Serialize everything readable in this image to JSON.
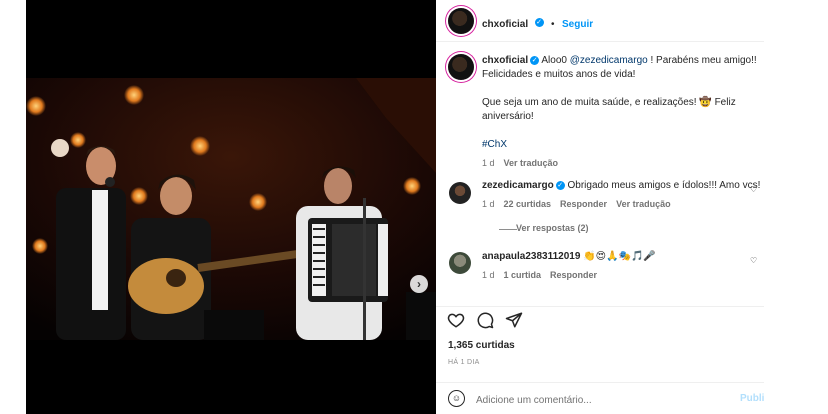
{
  "post": {
    "author": "chxoficial",
    "follow_label": "Seguir",
    "separator": "•",
    "caption_line1_prefix": "Aloo0 ",
    "caption_mention": "@zezedicamargo",
    "caption_line1_suffix": " ! Parabéns meu amigo!!",
    "caption_line2": "Felicidades e muitos anos de vida!",
    "caption_line3": "Que seja um ano de muita saúde, e realizações! 🤠 Feliz",
    "caption_line4": "aniversário!",
    "hashtag": "#ChX",
    "caption_time": "1 d",
    "see_translation": "Ver tradução",
    "carousel_count": 6,
    "carousel_active": 1
  },
  "comments": [
    {
      "user": "zezedicamargo",
      "verified": true,
      "text": "Obrigado meus amigos e ídolos!!! Amo vcs!",
      "time": "1 d",
      "likes": "22 curtidas",
      "reply": "Responder",
      "translate": "Ver tradução",
      "view_replies": "Ver respostas (2)"
    },
    {
      "user": "anapaula2383112019",
      "verified": false,
      "text": "👏😍🙏🎭🎵🎤",
      "time": "1 d",
      "likes": "1 curtida",
      "reply": "Responder"
    }
  ],
  "actions": {
    "like_icon": "heart-icon",
    "comment_icon": "comment-icon",
    "share_icon": "share-icon"
  },
  "likes_count": "1,365 curtidas",
  "posted_ago": "HÁ 1 DIA",
  "comment_box": {
    "placeholder": "Adicione um comentário...",
    "publish_label": "Publi",
    "emoji_icon": "emoji-icon"
  },
  "colors": {
    "accent": "#0095f6",
    "link": "#00376b",
    "muted": "#737373"
  }
}
